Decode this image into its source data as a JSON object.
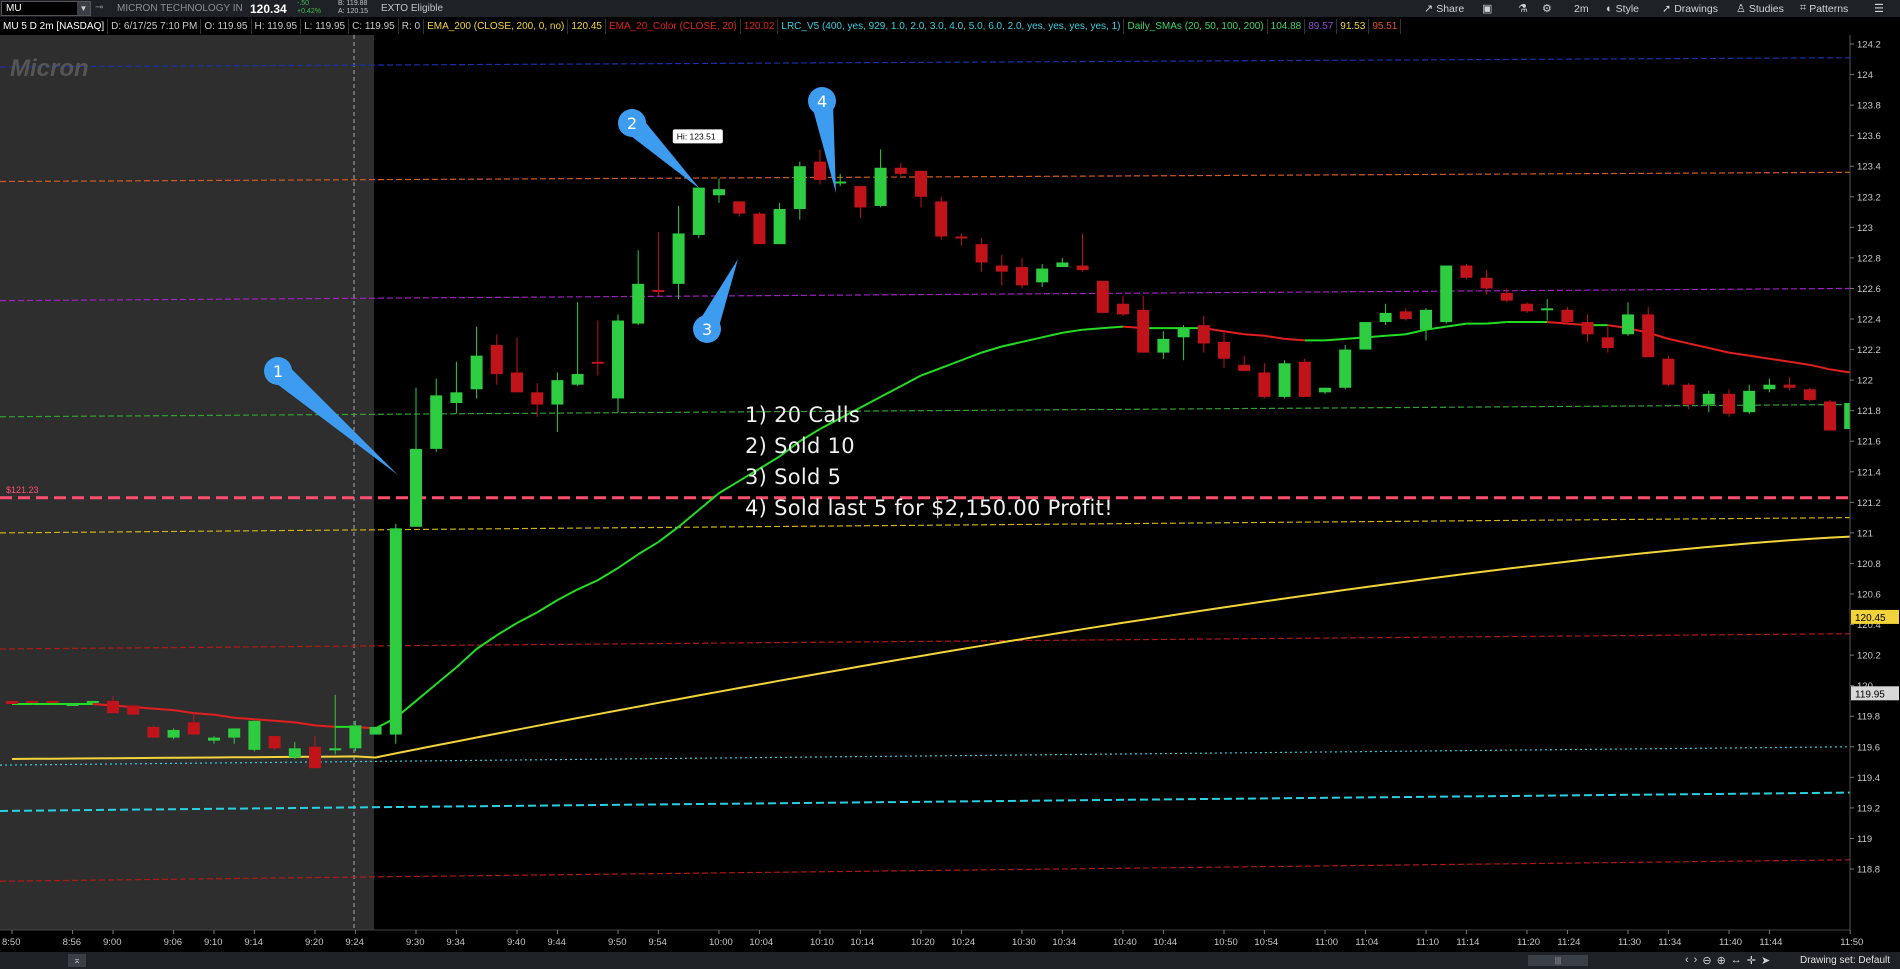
{
  "header": {
    "symbol": "MU",
    "company": "MICRON TECHNOLOGY IN",
    "last": "120.34",
    "change": "-.50",
    "change_pct": "+0.42%",
    "bid": "B: 119.88",
    "ask": "A: 120.15",
    "exto": "EXTO Eligible"
  },
  "toolbar": {
    "share": "Share",
    "timeframe": "2m",
    "style": "Style",
    "drawings": "Drawings",
    "studies": "Studies",
    "patterns": "Patterns"
  },
  "infobar": {
    "title": "MU 5 D 2m [NASDAQ]",
    "date": "D: 6/17/25 7:10 PM",
    "open": "O: 119.95",
    "high": "H: 119.95",
    "low": "L: 119.95",
    "close": "C: 119.95",
    "range": "R: 0",
    "ema200_label": "EMA_200 (CLOSE, 200, 0, no)",
    "ema200_value": "120.45",
    "ema20_label": "EMA_20_Color (CLOSE, 20)",
    "ema20_value": "120.02",
    "lrc_label": "LRC_V5 (400, yes, 929, 1.0, 2.0, 3.0, 4.0, 5.0, 6.0, 2.0, yes, yes, yes, yes, 1)",
    "sma_label": "Daily_SMAs (20, 50, 100, 200)",
    "sma20": "104.88",
    "sma50": "89.57",
    "sma100": "91.53",
    "sma200": "95.51"
  },
  "logo_text": "Micron",
  "hi_label": "Hi: 123.51",
  "level_label": "$121.23",
  "notes": [
    "1) 20 Calls",
    "2) Sold 10",
    "3) Sold 5",
    "4) Sold last 5 for $2,150.00 Profit!"
  ],
  "markers": [
    "1",
    "2",
    "3",
    "4"
  ],
  "footer": {
    "drawing_set": "Drawing set: Default"
  },
  "colors": {
    "up": "#2ecc40",
    "down": "#c0141a",
    "ema20_up": "#22dd22",
    "ema20_down": "#e21f1f",
    "ema200": "#f2d43a",
    "level": "#ff4f6e",
    "marker": "#3d9cf0",
    "premarket_bg": "#2e2e2e"
  },
  "chart_data": {
    "type": "candlestick",
    "xlabels": [
      "8:50",
      "8:56",
      "9:00",
      "9:06",
      "9:10",
      "9:14",
      "9:20",
      "9:24",
      "9:30",
      "9:34",
      "9:40",
      "9:44",
      "9:50",
      "9:54",
      "10:00",
      "10:04",
      "10:10",
      "10:14",
      "10:20",
      "10:24",
      "10:30",
      "10:34",
      "10:40",
      "10:44",
      "10:50",
      "10:54",
      "11:00",
      "11:04",
      "11:10",
      "11:14",
      "11:20",
      "11:24",
      "11:30",
      "11:34",
      "11:40",
      "11:44",
      "11:50"
    ],
    "yticks": [
      118.8,
      119,
      119.2,
      119.4,
      119.6,
      119.8,
      120,
      120.2,
      120.4,
      120.6,
      120.8,
      121,
      121.2,
      121.4,
      121.6,
      121.8,
      122,
      122.2,
      122.4,
      122.6,
      122.8,
      123,
      123.2,
      123.4,
      123.6,
      123.8,
      124,
      124.2
    ],
    "price_tags": {
      "ema200": "120.45",
      "last": "119.95"
    },
    "candles": [
      [
        119.9,
        119.9,
        119.88,
        119.88
      ],
      [
        119.9,
        119.9,
        119.89,
        119.89
      ],
      [
        119.9,
        119.9,
        119.89,
        119.89
      ],
      [
        119.87,
        119.88,
        119.87,
        119.88
      ],
      [
        119.9,
        119.9,
        119.89,
        119.9
      ],
      [
        119.9,
        119.93,
        119.82,
        119.82
      ],
      [
        119.87,
        119.87,
        119.81,
        119.81
      ],
      [
        119.73,
        119.74,
        119.66,
        119.66
      ],
      [
        119.66,
        119.72,
        119.65,
        119.71
      ],
      [
        119.76,
        119.82,
        119.68,
        119.68
      ],
      [
        119.64,
        119.67,
        119.62,
        119.66
      ],
      [
        119.66,
        119.72,
        119.62,
        119.72
      ],
      [
        119.58,
        119.77,
        119.57,
        119.77
      ],
      [
        119.67,
        119.67,
        119.58,
        119.59
      ],
      [
        119.53,
        119.63,
        119.52,
        119.59
      ],
      [
        119.6,
        119.67,
        119.46,
        119.46
      ],
      [
        119.58,
        119.94,
        119.55,
        119.59
      ],
      [
        119.59,
        119.77,
        119.57,
        119.74
      ],
      [
        119.68,
        119.73,
        119.68,
        119.73
      ],
      [
        119.68,
        121.06,
        119.62,
        121.03
      ],
      [
        121.04,
        121.95,
        121.04,
        121.55
      ],
      [
        121.55,
        122.01,
        121.53,
        121.9
      ],
      [
        121.85,
        122.12,
        121.78,
        121.92
      ],
      [
        121.94,
        122.35,
        121.88,
        122.16
      ],
      [
        122.23,
        122.3,
        121.97,
        122.04
      ],
      [
        122.05,
        122.28,
        121.92,
        121.92
      ],
      [
        121.92,
        121.98,
        121.76,
        121.84
      ],
      [
        121.84,
        122.05,
        121.66,
        122.0
      ],
      [
        121.97,
        122.51,
        121.96,
        122.04
      ],
      [
        122.12,
        122.39,
        122.03,
        122.11
      ],
      [
        121.88,
        122.43,
        121.79,
        122.39
      ],
      [
        122.37,
        122.85,
        122.36,
        122.63
      ],
      [
        122.59,
        122.97,
        122.55,
        122.58
      ],
      [
        122.63,
        123.14,
        122.53,
        122.96
      ],
      [
        122.95,
        123.26,
        122.93,
        123.26
      ],
      [
        123.21,
        123.32,
        123.16,
        123.25
      ],
      [
        123.17,
        123.17,
        123.07,
        123.09
      ],
      [
        123.09,
        123.1,
        122.9,
        122.89
      ],
      [
        122.89,
        123.16,
        122.89,
        123.12
      ],
      [
        123.12,
        123.43,
        123.05,
        123.4
      ],
      [
        123.43,
        123.51,
        123.28,
        123.31
      ],
      [
        123.3,
        123.35,
        123.27,
        123.3
      ],
      [
        123.27,
        123.27,
        123.06,
        123.13
      ],
      [
        123.14,
        123.51,
        123.13,
        123.39
      ],
      [
        123.39,
        123.42,
        123.34,
        123.35
      ],
      [
        123.37,
        123.37,
        123.13,
        123.2
      ],
      [
        123.17,
        123.2,
        122.92,
        122.94
      ],
      [
        122.94,
        122.96,
        122.88,
        122.93
      ],
      [
        122.89,
        122.93,
        122.71,
        122.77
      ],
      [
        122.75,
        122.82,
        122.62,
        122.71
      ],
      [
        122.74,
        122.8,
        122.6,
        122.62
      ],
      [
        122.64,
        122.76,
        122.61,
        122.73
      ],
      [
        122.74,
        122.8,
        122.74,
        122.77
      ],
      [
        122.75,
        122.96,
        122.71,
        122.72
      ],
      [
        122.65,
        122.65,
        122.48,
        122.44
      ],
      [
        122.5,
        122.55,
        122.42,
        122.43
      ],
      [
        122.46,
        122.55,
        122.22,
        122.18
      ],
      [
        122.18,
        122.32,
        122.14,
        122.27
      ],
      [
        122.28,
        122.36,
        122.13,
        122.34
      ],
      [
        122.36,
        122.42,
        122.18,
        122.24
      ],
      [
        122.25,
        122.31,
        122.08,
        122.14
      ],
      [
        122.1,
        122.16,
        122.06,
        122.06
      ],
      [
        122.05,
        122.11,
        121.88,
        121.89
      ],
      [
        121.89,
        122.13,
        121.88,
        122.11
      ],
      [
        122.12,
        122.14,
        121.89,
        121.89
      ],
      [
        121.92,
        121.95,
        121.91,
        121.95
      ],
      [
        121.95,
        122.23,
        121.94,
        122.2
      ],
      [
        122.2,
        122.38,
        122.21,
        122.38
      ],
      [
        122.38,
        122.5,
        122.36,
        122.44
      ],
      [
        122.45,
        122.47,
        122.39,
        122.4
      ],
      [
        122.33,
        122.47,
        122.26,
        122.46
      ],
      [
        122.38,
        122.75,
        122.37,
        122.75
      ],
      [
        122.75,
        122.76,
        122.66,
        122.67
      ],
      [
        122.67,
        122.72,
        122.56,
        122.6
      ],
      [
        122.57,
        122.6,
        122.51,
        122.52
      ],
      [
        122.5,
        122.51,
        122.44,
        122.45
      ],
      [
        122.46,
        122.53,
        122.39,
        122.47
      ],
      [
        122.46,
        122.48,
        122.37,
        122.38
      ],
      [
        122.38,
        122.43,
        122.25,
        122.3
      ],
      [
        122.28,
        122.35,
        122.18,
        122.21
      ],
      [
        122.3,
        122.51,
        122.29,
        122.43
      ],
      [
        122.43,
        122.48,
        122.16,
        122.15
      ],
      [
        122.14,
        122.16,
        121.96,
        121.97
      ],
      [
        121.97,
        121.98,
        121.81,
        121.84
      ],
      [
        121.84,
        121.93,
        121.79,
        121.91
      ],
      [
        121.91,
        121.94,
        121.76,
        121.78
      ],
      [
        121.79,
        121.97,
        121.78,
        121.93
      ],
      [
        121.94,
        122.01,
        121.92,
        121.97
      ],
      [
        121.97,
        122.02,
        121.93,
        121.95
      ],
      [
        121.94,
        121.95,
        121.86,
        121.87
      ],
      [
        121.86,
        121.87,
        121.67,
        121.67
      ],
      [
        121.68,
        121.86,
        121.68,
        121.85
      ]
    ],
    "ema20_series": [
      119.88,
      119.88,
      119.88,
      119.88,
      119.88,
      119.87,
      119.86,
      119.85,
      119.84,
      119.82,
      119.81,
      119.79,
      119.78,
      119.77,
      119.76,
      119.74,
      119.73,
      119.73,
      119.72,
      119.79,
      119.9,
      120.01,
      120.12,
      120.24,
      120.33,
      120.41,
      120.48,
      120.56,
      120.63,
      120.69,
      120.77,
      120.86,
      120.94,
      121.04,
      121.15,
      121.26,
      121.34,
      121.42,
      121.5,
      121.6,
      121.68,
      121.75,
      121.82,
      121.89,
      121.96,
      122.03,
      122.08,
      122.13,
      122.18,
      122.22,
      122.25,
      122.28,
      122.31,
      122.33,
      122.34,
      122.35,
      122.34,
      122.34,
      122.34,
      122.34,
      122.32,
      122.3,
      122.29,
      122.27,
      122.26,
      122.26,
      122.27,
      122.28,
      122.29,
      122.3,
      122.33,
      122.35,
      122.37,
      122.37,
      122.38,
      122.38,
      122.38,
      122.37,
      122.36,
      122.36,
      122.34,
      122.31,
      122.27,
      122.24,
      122.21,
      122.18,
      122.16,
      122.14,
      122.12,
      122.1,
      122.07,
      122.05
    ]
  }
}
